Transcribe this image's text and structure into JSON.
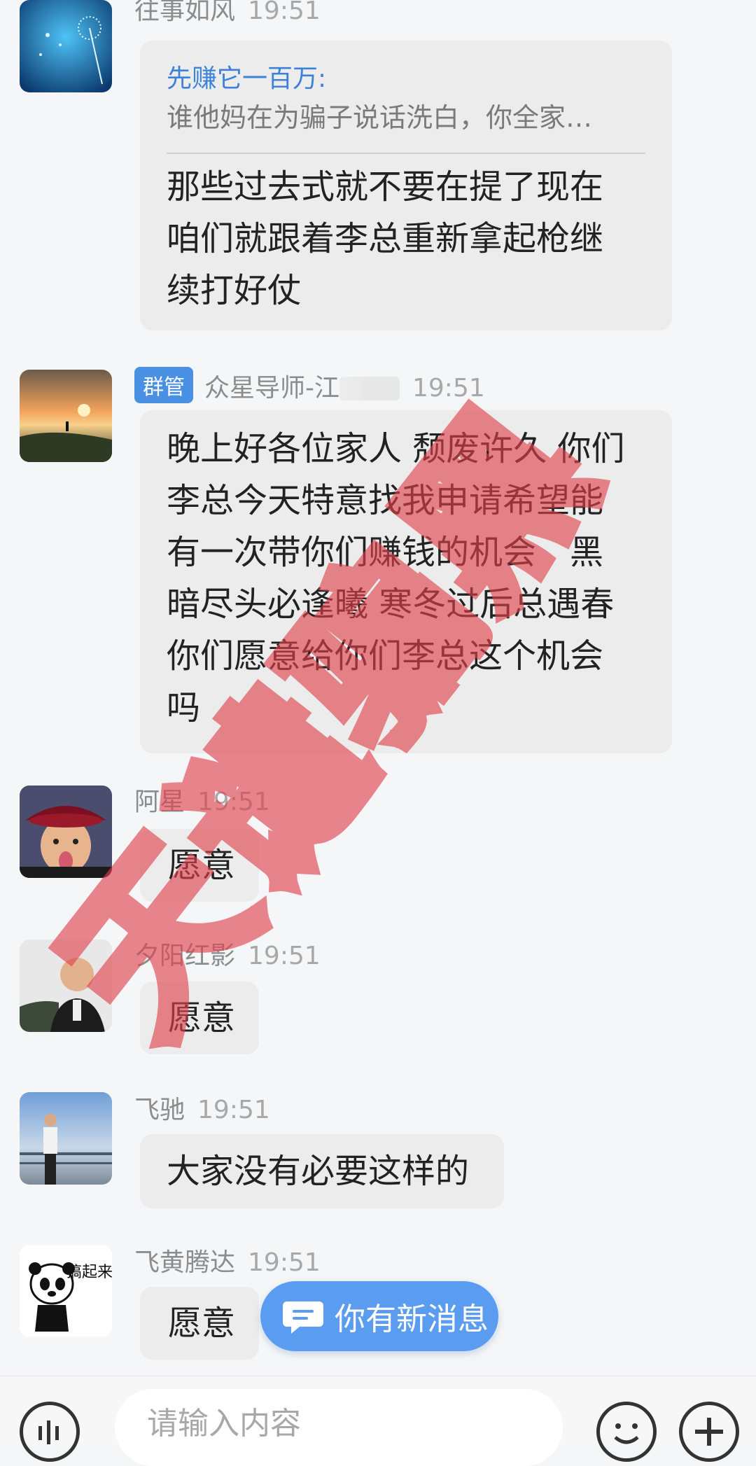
{
  "messages": [
    {
      "sender": "往事如风",
      "time": "19:51",
      "quote": {
        "name": "先赚它一百万:",
        "text": "谁他妈在为骗子说话洗白，你全家…"
      },
      "lines": [
        "那些过去式就不要在提了现在",
        "咱们就跟着李总重新拿起枪继",
        "续打好仗"
      ]
    },
    {
      "badge": "群管",
      "sender": "众星导师-江",
      "time": "19:51",
      "lines": [
        "晚上好各位家人 颓废许久 你们",
        "李总今天特意找我申请希望能",
        "有一次带你们赚钱的机会　黑",
        "暗尽头必逢曦 寒冬过后总遇春",
        "你们愿意给你们李总这个机会",
        "吗"
      ]
    },
    {
      "sender": "阿星",
      "time": "19:51",
      "lines": [
        "愿意"
      ]
    },
    {
      "sender": "夕阳红影",
      "time": "19:51",
      "lines": [
        "愿意"
      ]
    },
    {
      "sender": "飞驰",
      "time": "19:51",
      "lines": [
        "大家没有必要这样的"
      ]
    },
    {
      "sender": "飞黄腾达",
      "time": "19:51",
      "lines": [
        "愿意"
      ]
    }
  ],
  "avatar_art": {
    "panda_text": "搞起来"
  },
  "new_message_pill": {
    "label": "你有新消息",
    "icon": "chat-bubble-icon"
  },
  "input_bar": {
    "placeholder": "请输入内容",
    "left_icon": "voice-icon",
    "emoji_icon": "smile-icon",
    "plus_icon": "plus-icon"
  },
  "watermark": {
    "text": "天谴骗黑",
    "color": "#e0404a"
  },
  "colors": {
    "accent": "#4a90e2",
    "pill": "#5a9cf0",
    "background": "#f5f6f7",
    "bubble": "#ececed"
  }
}
